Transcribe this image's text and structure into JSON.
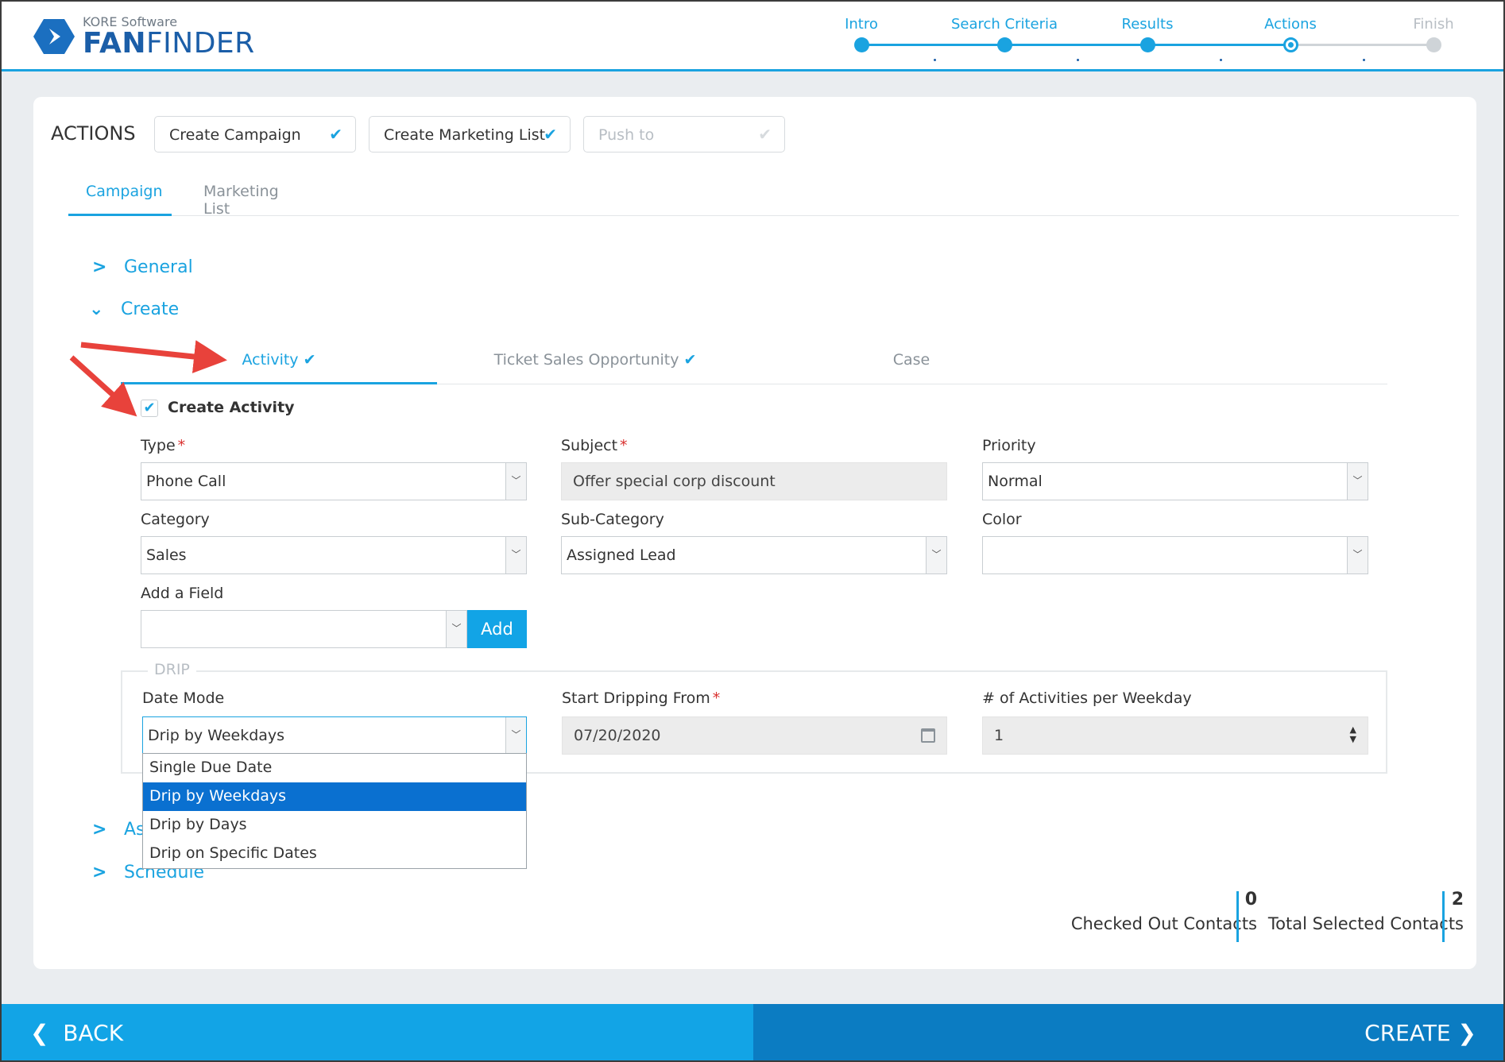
{
  "brand": {
    "sub": "KORE Software",
    "main_bold": "FAN",
    "main_rest": "FINDER",
    "color": "#1b5ea8"
  },
  "steps": [
    {
      "label": "Intro"
    },
    {
      "label": "Search Criteria"
    },
    {
      "label": "Results"
    },
    {
      "label": "Actions"
    },
    {
      "label": "Finish"
    }
  ],
  "actions": {
    "title": "ACTIONS",
    "buttons": [
      "Create Campaign",
      "Create Marketing List",
      "Push to"
    ]
  },
  "tabs": [
    "Campaign",
    "Marketing List"
  ],
  "sections": {
    "general": "General",
    "create": "Create",
    "assign": "As",
    "schedule": "Schedule"
  },
  "subtabs": [
    "Activity",
    "Ticket Sales Opportunity",
    "Case"
  ],
  "create_activity": "Create Activity",
  "fields": {
    "type": {
      "label": "Type",
      "value": "Phone Call"
    },
    "subject": {
      "label": "Subject",
      "value": "Offer special corp discount"
    },
    "priority": {
      "label": "Priority",
      "value": "Normal"
    },
    "category": {
      "label": "Category",
      "value": "Sales"
    },
    "sub_category": {
      "label": "Sub-Category",
      "value": "Assigned Lead"
    },
    "color": {
      "label": "Color",
      "value": ""
    },
    "add_field": {
      "label": "Add a Field",
      "value": "",
      "button": "Add"
    }
  },
  "drip": {
    "legend": "DRIP",
    "date_mode": {
      "label": "Date Mode",
      "value": "Drip by Weekdays"
    },
    "start": {
      "label": "Start Dripping From",
      "value": "07/20/2020"
    },
    "per_weekday": {
      "label": "# of Activities per Weekday",
      "value": "1"
    },
    "options": [
      "Single Due Date",
      "Drip by Weekdays",
      "Drip by Days",
      "Drip on Specific Dates"
    ],
    "selected_option": "Drip by Weekdays"
  },
  "stats": {
    "checked_out": {
      "value": "0",
      "label": "Checked Out Contacts"
    },
    "total_selected": {
      "value": "2",
      "label": "Total Selected Contacts"
    }
  },
  "footer": {
    "back": "BACK",
    "create": "CREATE"
  },
  "colors": {
    "accent": "#1aa3e0",
    "primary_dark": "#0b7cc2",
    "selected": "#0a70d0",
    "annotation": "#e8423b"
  }
}
